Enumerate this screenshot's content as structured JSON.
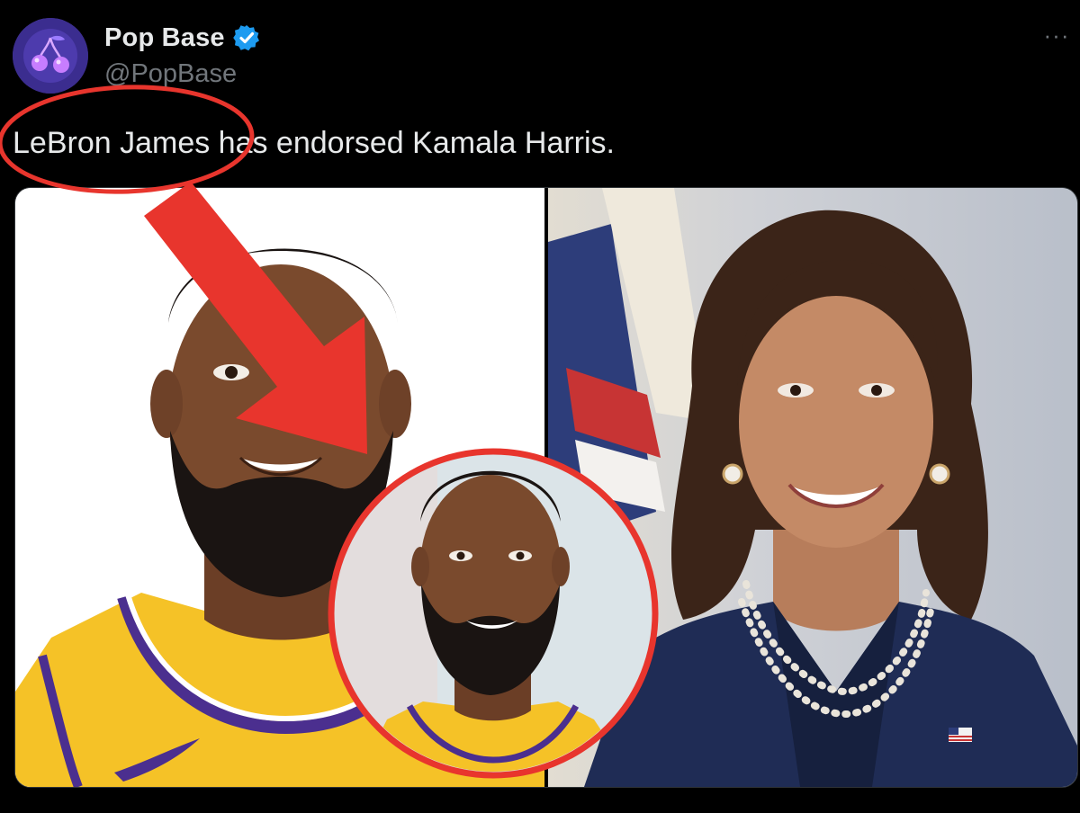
{
  "tweet": {
    "display_name": "Pop Base",
    "verified": true,
    "handle": "@PopBase",
    "text": "LeBron James has endorsed Kamala Harris.",
    "more_icon": "more-horizontal-icon"
  },
  "media": {
    "images": [
      {
        "subject": "LeBron James portrait"
      },
      {
        "subject": "Kamala Harris portrait"
      }
    ]
  },
  "annotations": {
    "color": "#e8352d",
    "shapes": [
      "ellipse around text",
      "arrow",
      "circle inset"
    ]
  },
  "colors": {
    "background": "#000000",
    "text_primary": "#e7e9ea",
    "text_secondary": "#71767b",
    "verified_blue": "#1d9bf0",
    "annotation_red": "#e8352d"
  }
}
